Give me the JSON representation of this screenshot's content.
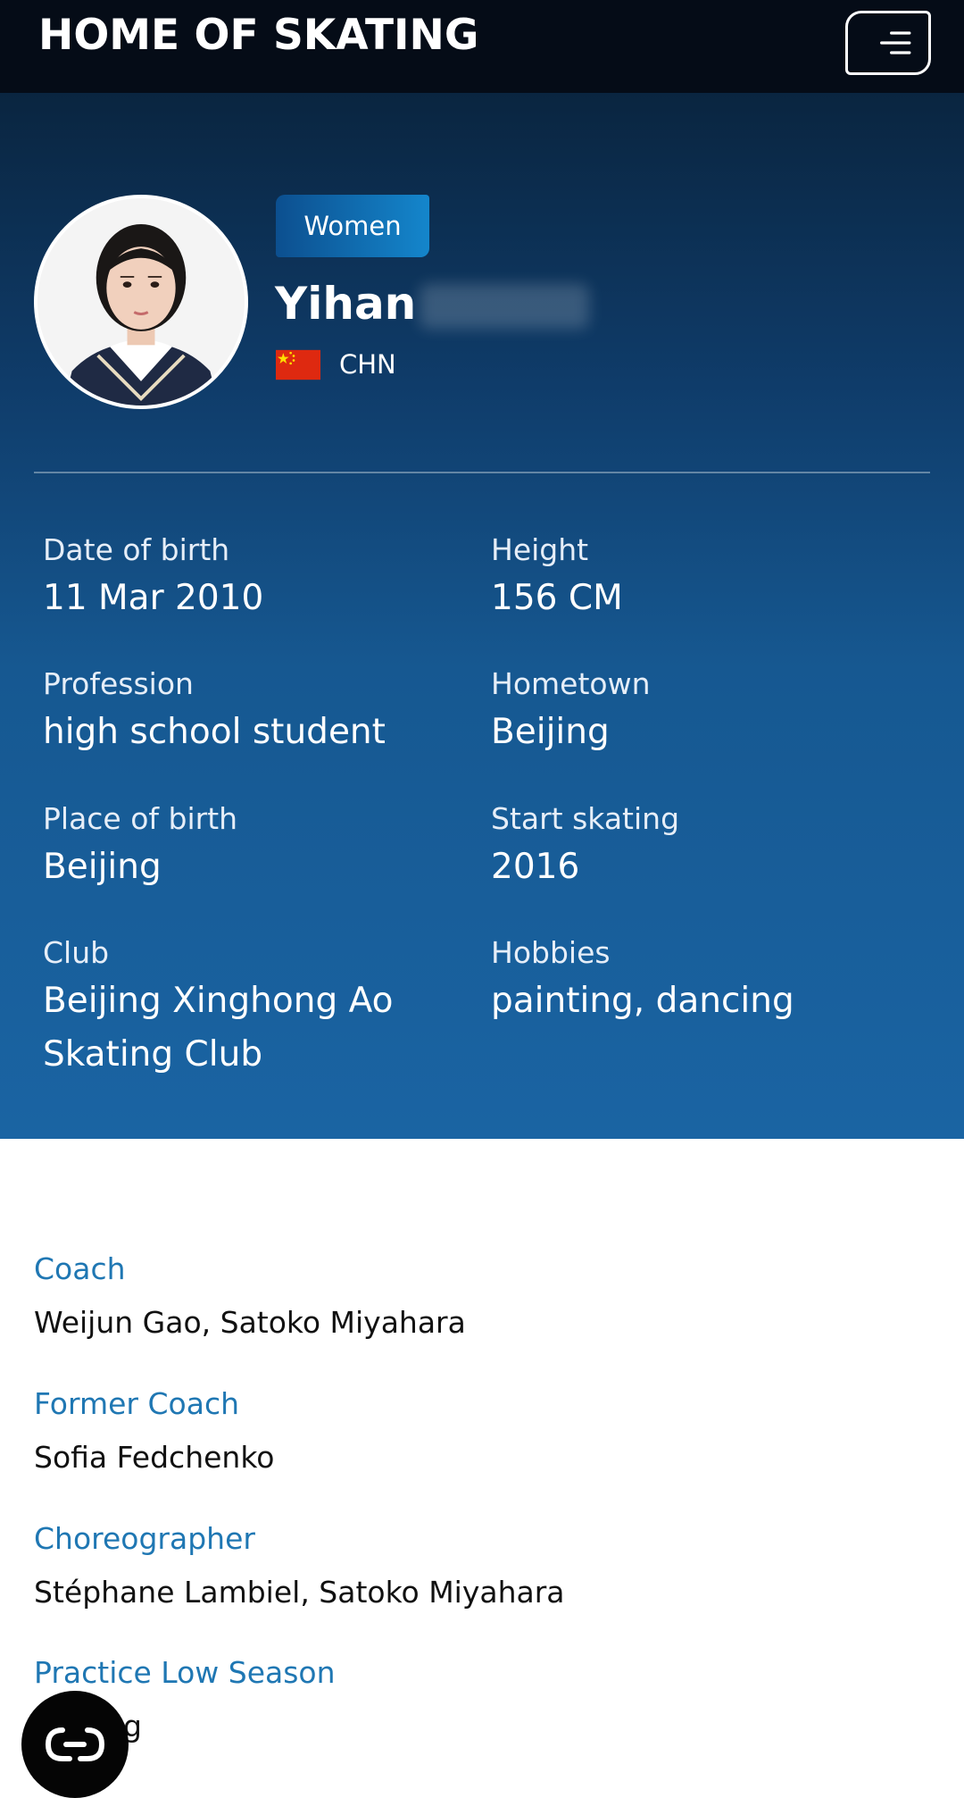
{
  "header": {
    "brand": "HOME OF SKATING",
    "menu_icon": "hamburger-menu-icon"
  },
  "profile": {
    "category": "Women",
    "name": "Yihan",
    "nation": "CHN",
    "flag_icon": "china-flag-icon"
  },
  "details": [
    {
      "label": "Date of birth",
      "value": "11 Mar 2010"
    },
    {
      "label": "Height",
      "value": "156 CM"
    },
    {
      "label": "Profession",
      "value": "high school student"
    },
    {
      "label": "Hometown",
      "value": "Beijing"
    },
    {
      "label": "Place of birth",
      "value": "Beijing"
    },
    {
      "label": "Start skating",
      "value": "2016"
    },
    {
      "label": "Club",
      "value": "Beijing Xinghong Ao Skating Club"
    },
    {
      "label": "Hobbies",
      "value": "painting, dancing"
    }
  ],
  "staff": [
    {
      "label": "Coach",
      "value": "Weijun Gao, Satoko Miyahara"
    },
    {
      "label": "Former Coach",
      "value": "Sofia Fedchenko"
    },
    {
      "label": "Choreographer",
      "value": "Stéphane Lambiel, Satoko Miyahara"
    },
    {
      "label": "Practice Low Season",
      "value": "g"
    }
  ],
  "colors": {
    "topbar": "#050c17",
    "hero_gradient_start": "#0a2540",
    "hero_gradient_end": "#1a64a3",
    "staff_label": "#1f77b3"
  },
  "chat_icon": "chat-bubble-icon"
}
